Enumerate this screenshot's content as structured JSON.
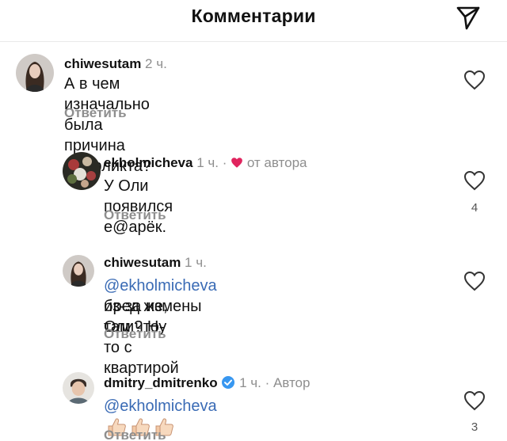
{
  "header": {
    "title": "Комментарии",
    "icon": "send-icon"
  },
  "comments": [
    {
      "username": "chiwesutam",
      "time": "2 ч.",
      "text": "А в чем изначально была причина конфликта?",
      "reply_label": "Ответить",
      "like_count": ""
    },
    {
      "username": "ekholmicheva",
      "time": "1 ч.",
      "separator": "·",
      "liked_by_author": "от автора",
      "text": "У Оли появился е@арёк.",
      "reply_label": "Ответить",
      "like_count": "4"
    },
    {
      "username": "chiwesutam",
      "time": "1 ч.",
      "mention": "@ekholmicheva",
      "text_line1": "из-за измены Оли? Ну",
      "text_line2": "бред же, там что-то с квартирой",
      "reply_label": "Ответить",
      "like_count": ""
    },
    {
      "username": "dmitry_dmitrenko",
      "time": "1 ч.",
      "separator": "·",
      "author_badge": "Автор",
      "mention": "@ekholmicheva",
      "emoji": [
        "thumbs-up-emoji",
        "thumbs-up-emoji",
        "thumbs-up-emoji"
      ],
      "reply_label": "Ответить",
      "like_count": "3"
    }
  ],
  "colors": {
    "mention": "#3a6bb5",
    "heart": "#e0245e",
    "verified": "#3897f0",
    "muted": "#8e8e8e"
  }
}
